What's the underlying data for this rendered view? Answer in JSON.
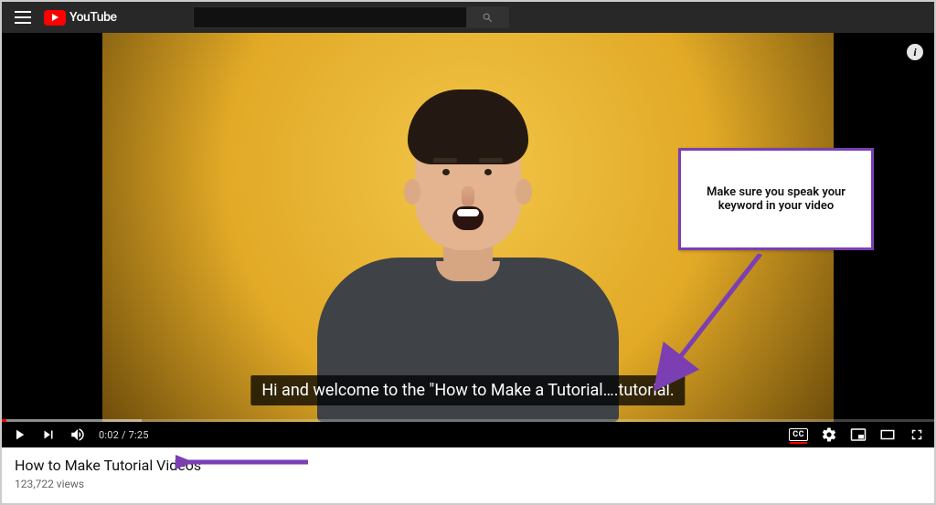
{
  "header": {
    "logo_text": "YouTube",
    "search_placeholder": ""
  },
  "player": {
    "caption_text": "Hi and welcome to the \"How to Make a Tutorial….tutorial.",
    "time_current": "0:02",
    "time_duration": "7:25",
    "time_display": "0:02 / 7:25",
    "cc_label": "CC",
    "info_label": "i"
  },
  "annotation": {
    "callout_text": "Make sure you speak your keyword in your video"
  },
  "meta": {
    "title": "How to Make Tutorial Videos",
    "views": "123,722 views"
  },
  "colors": {
    "brand_red": "#ff0000",
    "annotation_purple": "#7b3fb3"
  }
}
